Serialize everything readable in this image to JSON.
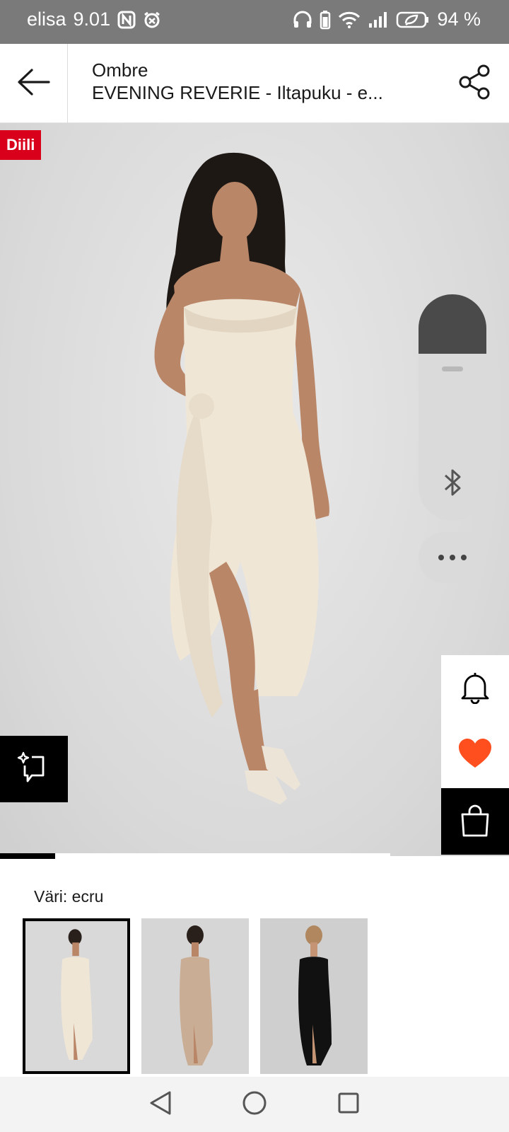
{
  "status_bar": {
    "carrier": "elisa",
    "time": "9.01",
    "battery": "94 %",
    "left_icons": [
      "nfc-icon",
      "alarm-icon"
    ],
    "right_icons": [
      "headphones-icon",
      "battery-small-icon",
      "wifi-icon",
      "signal-icon",
      "battery-saver-icon"
    ]
  },
  "header": {
    "brand": "Ombre",
    "title": "EVENING REVERIE - Iltapuku - e...",
    "back_icon": "arrow-left-icon",
    "share_icon": "share-icon"
  },
  "hero": {
    "deal_badge": "Diili",
    "image_counter": {
      "current": 1,
      "total": 7
    }
  },
  "side_actions": [
    {
      "name": "notify-button",
      "icon": "bell-icon"
    },
    {
      "name": "wishlist-button",
      "icon": "heart-icon"
    },
    {
      "name": "add-to-bag-button",
      "icon": "bag-icon"
    }
  ],
  "colors": {
    "accent": "#ff4f1f",
    "deal": "#d8001a",
    "black": "#000000"
  },
  "color_section": {
    "label": "Väri: ecru",
    "thumbnails": [
      {
        "color": "ecru",
        "selected": true
      },
      {
        "color": "taupe",
        "selected": false
      },
      {
        "color": "black",
        "selected": false
      }
    ]
  },
  "navbar": [
    "back-triangle-icon",
    "home-circle-icon",
    "recents-square-icon"
  ]
}
